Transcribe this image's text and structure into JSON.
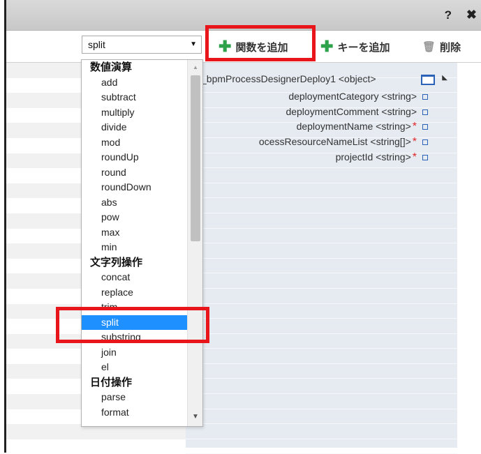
{
  "window": {
    "help_label": "?",
    "close_label": "✖"
  },
  "toolbar": {
    "function_select_value": "split",
    "add_function_label": "関数を追加",
    "add_key_label": "キーを追加",
    "delete_label": "削除"
  },
  "tree": {
    "root": {
      "label": "_bpmProcessDesignerDeploy1 <object>"
    },
    "rows": [
      {
        "label": "deploymentCategory <string>",
        "required": ""
      },
      {
        "label": "deploymentComment <string>",
        "required": ""
      },
      {
        "label": "deploymentName <string>",
        "required": "*"
      },
      {
        "label": "ocessResourceNameList <string[]>",
        "required": "*"
      },
      {
        "label": "projectId <string>",
        "required": "*"
      }
    ]
  },
  "dropdown": {
    "groups": [
      {
        "label": "数値演算",
        "items": [
          "add",
          "subtract",
          "multiply",
          "divide",
          "mod",
          "roundUp",
          "round",
          "roundDown",
          "abs",
          "pow",
          "max",
          "min"
        ]
      },
      {
        "label": "文字列操作",
        "items": [
          "concat",
          "replace",
          "trim",
          "split",
          "substring",
          "join",
          "el"
        ]
      },
      {
        "label": "日付操作",
        "items": [
          "parse",
          "format"
        ]
      }
    ],
    "selected": "split"
  },
  "colors": {
    "highlight_border": "#e8151b",
    "selected_bg": "#1e90ff",
    "add_icon": "#2ea24a",
    "right_pane_bg": "#e6ebf2",
    "required_marker": "#e0262a"
  }
}
